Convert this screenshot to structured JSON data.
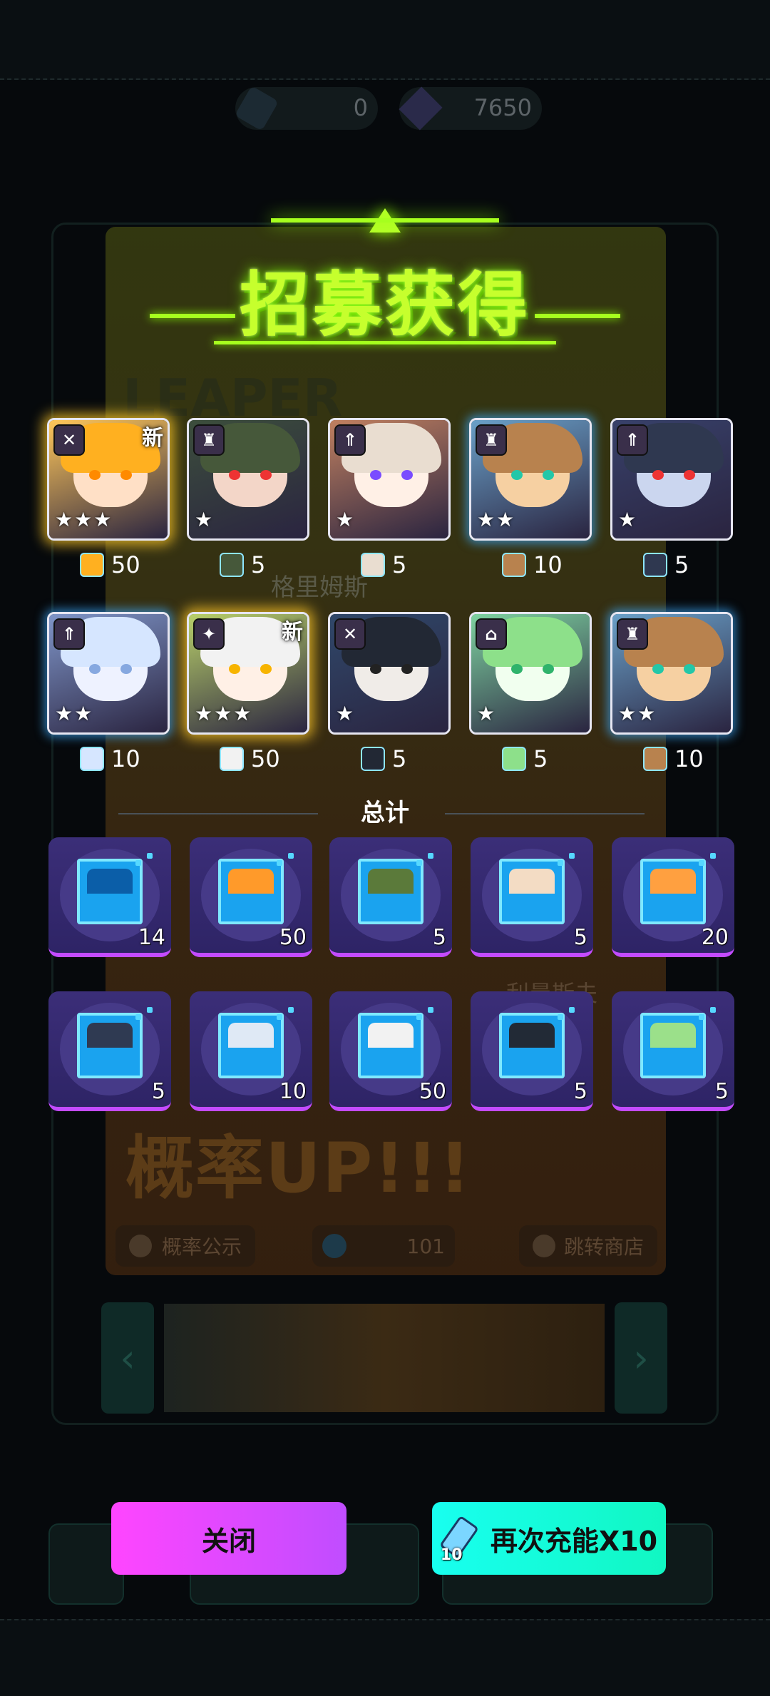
{
  "currency": {
    "ticket_count": "0",
    "crystal_count": "7650"
  },
  "background": {
    "big_text": "概率UP!!!",
    "watermark_top": "LEAPER",
    "name_1": "格里姆斯",
    "name_2": "利曼斯夫",
    "chip_left": "概率公示",
    "chip_mid": "101",
    "chip_right": "跳转商店"
  },
  "title": "招募获得",
  "recruited": [
    {
      "role_icon": "crossed-swords-icon",
      "stars": "★★★",
      "is_new": true,
      "new_label": "新",
      "count": "50",
      "hair": "#ffb020",
      "skin": "#ffe0c6",
      "eye": "#ff8a00",
      "bg": "#ffc75a"
    },
    {
      "role_icon": "tower-icon",
      "stars": "★",
      "is_new": false,
      "new_label": "",
      "count": "5",
      "hair": "#46583a",
      "skin": "#f3d6c8",
      "eye": "#e33",
      "bg": "#3c4e3c"
    },
    {
      "role_icon": "arrow-up-icon",
      "stars": "★",
      "is_new": false,
      "new_label": "",
      "count": "5",
      "hair": "#e9ddd0",
      "skin": "#fff0e6",
      "eye": "#7a4cff",
      "bg": "#c08060"
    },
    {
      "role_icon": "tower-icon",
      "stars": "★★",
      "is_new": false,
      "new_label": "",
      "count": "10",
      "hair": "#b8824e",
      "skin": "#f6d0a2",
      "eye": "#23c7a8",
      "bg": "#6aa0c8"
    },
    {
      "role_icon": "arrow-up-icon",
      "stars": "★",
      "is_new": false,
      "new_label": "",
      "count": "5",
      "hair": "#2f3850",
      "skin": "#cbd6ef",
      "eye": "#e33",
      "bg": "#38416a"
    },
    {
      "role_icon": "arrow-up-icon",
      "stars": "★★",
      "is_new": false,
      "new_label": "",
      "count": "10",
      "hair": "#d6e6ff",
      "skin": "#eef2ff",
      "eye": "#86a8e0",
      "bg": "#7f95c8"
    },
    {
      "role_icon": "crossbow-icon",
      "stars": "★★★",
      "is_new": true,
      "new_label": "新",
      "count": "50",
      "hair": "#f2f2f2",
      "skin": "#fff0e6",
      "eye": "#f7b400",
      "bg": "#b9d06a"
    },
    {
      "role_icon": "crossed-swords-icon",
      "stars": "★",
      "is_new": false,
      "new_label": "",
      "count": "5",
      "hair": "#222834",
      "skin": "#f0ece8",
      "eye": "#222",
      "bg": "#30486a"
    },
    {
      "role_icon": "up-arrow-house-icon",
      "stars": "★",
      "is_new": false,
      "new_label": "",
      "count": "5",
      "hair": "#8de08a",
      "skin": "#f1ffef",
      "eye": "#2fb36b",
      "bg": "#7ed2a0"
    },
    {
      "role_icon": "tower-icon",
      "stars": "★★",
      "is_new": false,
      "new_label": "",
      "count": "10",
      "hair": "#b8824e",
      "skin": "#f6d0a2",
      "eye": "#23c7a8",
      "bg": "#6aa0c8"
    }
  ],
  "total_label": "总计",
  "totals": [
    {
      "item": "dna-chip-icon",
      "qty": "14",
      "px": "#0b5ea8"
    },
    {
      "item": "orange-hair-chip-icon",
      "qty": "50",
      "px": "#ff9a2a"
    },
    {
      "item": "green-helmet-chip-icon",
      "qty": "5",
      "px": "#5b7a3a"
    },
    {
      "item": "cream-hair-chip-icon",
      "qty": "5",
      "px": "#f3dcc4"
    },
    {
      "item": "fox-chip-icon",
      "qty": "20",
      "px": "#ffa040"
    },
    {
      "item": "dark-hood-chip-icon",
      "qty": "5",
      "px": "#2f3a52"
    },
    {
      "item": "white-hair-chip-icon",
      "qty": "10",
      "px": "#dfe9f5"
    },
    {
      "item": "white-hair-glasses-chip-icon",
      "qty": "50",
      "px": "#f2f2f2"
    },
    {
      "item": "captain-cat-chip-icon",
      "qty": "5",
      "px": "#222a36"
    },
    {
      "item": "green-hair-chip-icon",
      "qty": "5",
      "px": "#9be08a"
    }
  ],
  "buttons": {
    "close_label": "关闭",
    "again_label": "再次充能X10",
    "again_cost": "10"
  },
  "colors": {
    "title_green": "#c6ff2d",
    "close_btn": "#ff45ff",
    "again_btn": "#18fff0",
    "tile_purple": "#3b2e78",
    "tile_border": "#c34bff"
  }
}
